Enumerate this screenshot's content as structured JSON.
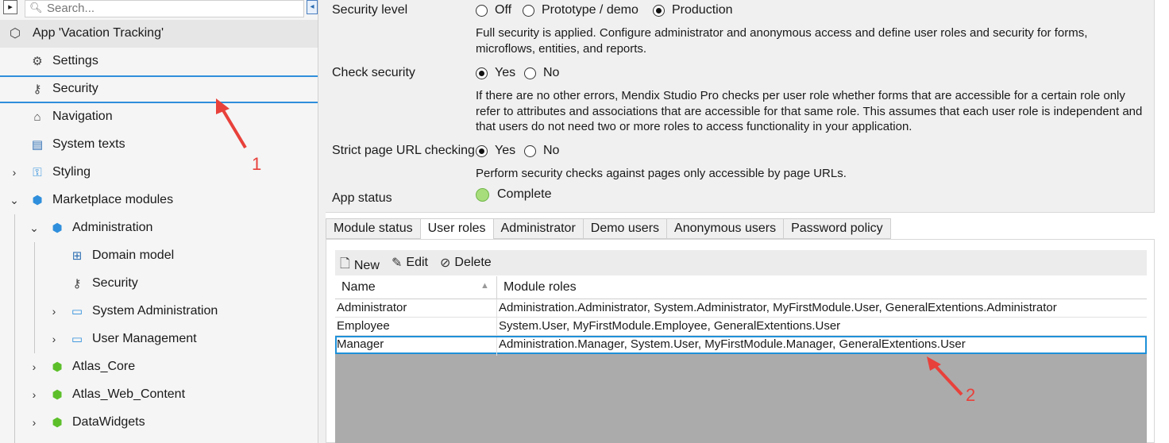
{
  "search": {
    "placeholder": "Search..."
  },
  "tree": {
    "app": "App 'Vacation Tracking'",
    "items": [
      {
        "label": "Settings"
      },
      {
        "label": "Security"
      },
      {
        "label": "Navigation"
      },
      {
        "label": "System texts"
      },
      {
        "label": "Styling"
      },
      {
        "label": "Marketplace modules"
      },
      {
        "label": "Administration"
      },
      {
        "label": "Domain model"
      },
      {
        "label": "Security"
      },
      {
        "label": "System Administration"
      },
      {
        "label": "User Management"
      },
      {
        "label": "Atlas_Core"
      },
      {
        "label": "Atlas_Web_Content"
      },
      {
        "label": "DataWidgets"
      }
    ]
  },
  "settings": {
    "security_level": {
      "label": "Security level",
      "options": [
        "Off",
        "Prototype / demo",
        "Production"
      ],
      "selected": "Production",
      "description": "Full security is applied. Configure administrator and anonymous access and define user roles and security for forms, microflows, entities, and reports."
    },
    "check_security": {
      "label": "Check security",
      "options": [
        "Yes",
        "No"
      ],
      "selected": "Yes",
      "description": "If there are no other errors, Mendix Studio Pro checks per user role whether forms that are accessible for a certain role only refer to attributes and associations that are accessible for that same role. This assumes that each user role is independent and that users do not need two or more roles to access functionality in your application."
    },
    "strict_url": {
      "label": "Strict page URL checking",
      "options": [
        "Yes",
        "No"
      ],
      "selected": "Yes",
      "description": "Perform security checks against pages only accessible by page URLs."
    },
    "app_status": {
      "label": "App status",
      "value": "Complete",
      "color": "#a8dd7c"
    }
  },
  "tabs": [
    "Module status",
    "User roles",
    "Administrator",
    "Demo users",
    "Anonymous users",
    "Password policy"
  ],
  "active_tab": "User roles",
  "toolbar": {
    "new": "New",
    "edit": "Edit",
    "delete": "Delete"
  },
  "grid": {
    "columns": [
      "Name",
      "Module roles"
    ],
    "rows": [
      {
        "name": "Administrator",
        "roles": "Administration.Administrator, System.Administrator, MyFirstModule.User, GeneralExtentions.Administrator"
      },
      {
        "name": "Employee",
        "roles": "System.User, MyFirstModule.Employee, GeneralExtentions.User"
      },
      {
        "name": "Manager",
        "roles": "Administration.Manager, System.User, MyFirstModule.Manager, GeneralExtentions.User"
      }
    ],
    "selected_row": "Manager"
  },
  "annotations": {
    "one": "1",
    "two": "2",
    "color": "#e8413b"
  }
}
